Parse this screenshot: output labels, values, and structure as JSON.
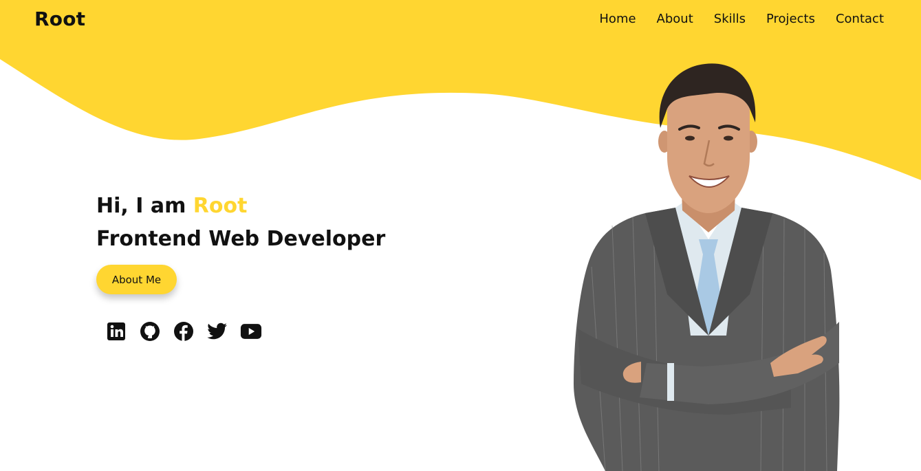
{
  "brand": {
    "logo": "Root"
  },
  "nav": {
    "items": [
      "Home",
      "About",
      "Skills",
      "Projects",
      "Contact"
    ]
  },
  "hero": {
    "greeting_prefix": "Hi, I am ",
    "name": "Root",
    "role": "Frontend Web Developer",
    "cta_label": "About Me"
  },
  "social": {
    "icons": [
      "linkedin-icon",
      "github-icon",
      "facebook-icon",
      "twitter-icon",
      "youtube-icon"
    ]
  },
  "colors": {
    "accent": "#ffd631",
    "text": "#111111",
    "background": "#ffffff",
    "suit": "#5b5b5b",
    "shirt": "#dfe9ef",
    "tie": "#a9c9e4",
    "skin": "#d9a27e",
    "hair": "#2e2521"
  }
}
